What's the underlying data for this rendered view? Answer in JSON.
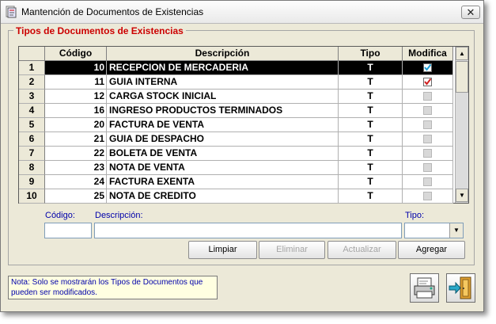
{
  "window": {
    "title": "Mantención de Documentos  de Existencias",
    "close_glyph": "✕"
  },
  "group": {
    "title": "Tipos de Documentos de Existencias"
  },
  "grid": {
    "columns": [
      "",
      "Código",
      "Descripción",
      "Tipo",
      "Modifica"
    ],
    "rows": [
      {
        "num": "1",
        "codigo": "10",
        "descripcion": "RECEPCION DE MERCADERIA",
        "tipo": "T",
        "modifica": true,
        "selected": true
      },
      {
        "num": "2",
        "codigo": "11",
        "descripcion": "GUIA INTERNA",
        "tipo": "T",
        "modifica": true,
        "selected": false
      },
      {
        "num": "3",
        "codigo": "12",
        "descripcion": "CARGA STOCK INICIAL",
        "tipo": "T",
        "modifica": false,
        "selected": false
      },
      {
        "num": "4",
        "codigo": "16",
        "descripcion": "INGRESO PRODUCTOS TERMINADOS",
        "tipo": "T",
        "modifica": false,
        "selected": false
      },
      {
        "num": "5",
        "codigo": "20",
        "descripcion": "FACTURA DE VENTA",
        "tipo": "T",
        "modifica": false,
        "selected": false
      },
      {
        "num": "6",
        "codigo": "21",
        "descripcion": "GUIA DE DESPACHO",
        "tipo": "T",
        "modifica": false,
        "selected": false
      },
      {
        "num": "7",
        "codigo": "22",
        "descripcion": "BOLETA DE VENTA",
        "tipo": "T",
        "modifica": false,
        "selected": false
      },
      {
        "num": "8",
        "codigo": "23",
        "descripcion": "NOTA DE VENTA",
        "tipo": "T",
        "modifica": false,
        "selected": false
      },
      {
        "num": "9",
        "codigo": "24",
        "descripcion": "FACTURA EXENTA",
        "tipo": "T",
        "modifica": false,
        "selected": false
      },
      {
        "num": "10",
        "codigo": "25",
        "descripcion": "NOTA DE CREDITO",
        "tipo": "T",
        "modifica": false,
        "selected": false
      }
    ],
    "scroll_up": "▲",
    "scroll_down": "▼",
    "check_colors": {
      "selected": "#1e9fd6",
      "normal": "#d02020"
    }
  },
  "form": {
    "codigo_label": "Código:",
    "descripcion_label": "Descripción:",
    "tipo_label": "Tipo:",
    "codigo_value": "",
    "descripcion_value": "",
    "tipo_value": "",
    "dropdown_glyph": "▼"
  },
  "buttons": {
    "limpiar": "Limpiar",
    "eliminar": "Eliminar",
    "actualizar": "Actualizar",
    "agregar": "Agregar"
  },
  "note": "Nota: Solo se mostrarán los Tipos de Documentos que pueden ser modificados.",
  "icons": {
    "print": "printer-icon",
    "exit": "exit-door-icon"
  }
}
